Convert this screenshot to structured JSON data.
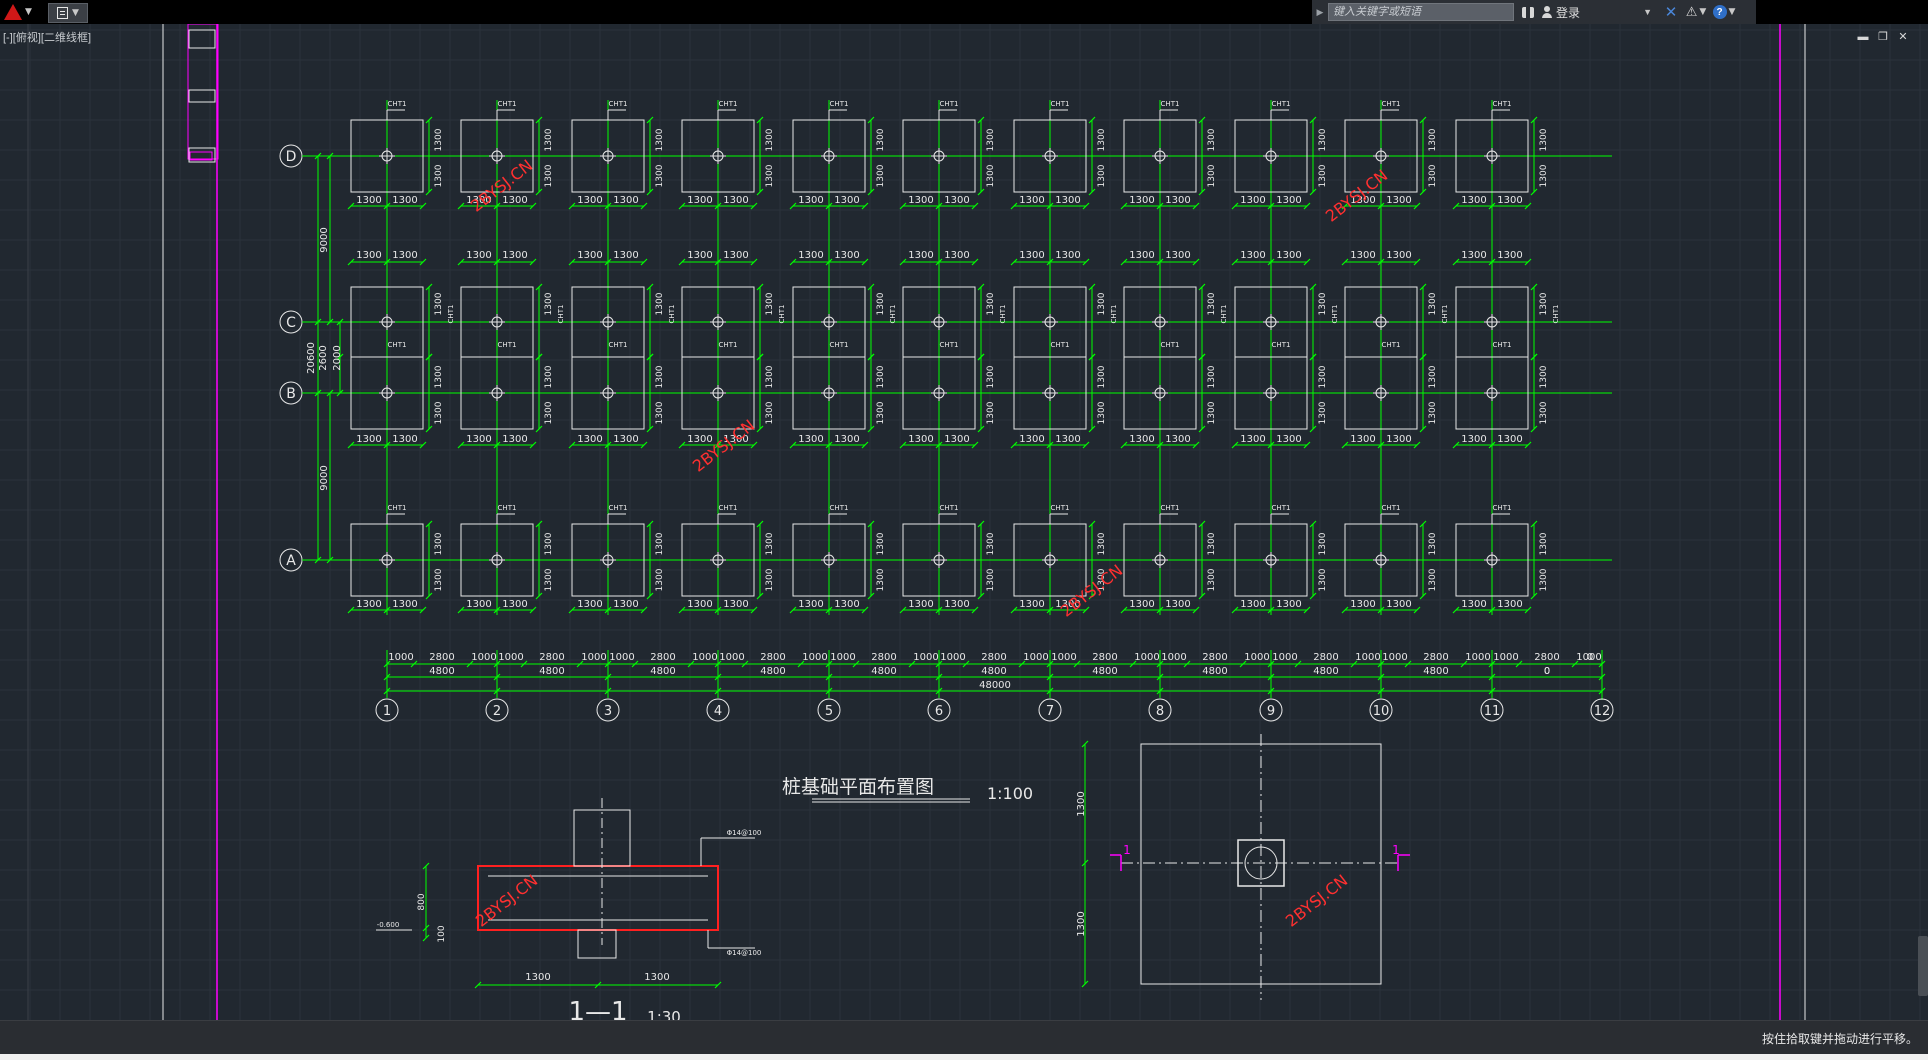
{
  "app": {
    "search_placeholder": "键入关键字或短语",
    "login_label": "登录",
    "viewport_label": "[-][俯视][二维线框]",
    "status_text": "按住拾取键并拖动进行平移。"
  },
  "drawing": {
    "plan_title": "桩基础平面布置图",
    "plan_scale": "1:100",
    "section_title": "1—1",
    "section_scale": "1:30",
    "watermark": "2BYSJ.CN",
    "cap_label": "CHT1",
    "cap_dim": "1300",
    "axis_rows": [
      "D",
      "C",
      "B",
      "A"
    ],
    "axis_cols": [
      "1",
      "2",
      "3",
      "4",
      "5",
      "6",
      "7",
      "8",
      "9",
      "10",
      "11",
      "12"
    ],
    "left_dims": {
      "top": "9000",
      "overall": "20600",
      "mid_a": "2600",
      "mid_b": "2000",
      "bottom": "9000"
    },
    "bottom_dims": {
      "row1": [
        "1000",
        "2800",
        "1000",
        "1000",
        "2800",
        "1000",
        "1000",
        "2800",
        "1000",
        "1000",
        "2800",
        "1000",
        "1000",
        "2800",
        "1000",
        "1000",
        "2800",
        "1000",
        "1000",
        "2800",
        "1000",
        "1000",
        "2800",
        "1000",
        "1000",
        "2800",
        "1000",
        "1000",
        "2800",
        "1000",
        "1000",
        "2800",
        "1000",
        "1000",
        "0",
        "0",
        "0"
      ],
      "row2": [
        "4800",
        "4800",
        "4800",
        "4800",
        "4800",
        "4800",
        "4800",
        "4800",
        "4800",
        "4800",
        "0"
      ],
      "total": "48000"
    },
    "section": {
      "level_mark": "-0.600",
      "rebar_top": "Φ14@100",
      "rebar_bottom": "Φ14@100",
      "dim_height": "800",
      "dim_small": "100",
      "dim_half": "1300"
    },
    "detail": {
      "dim_top": "1300",
      "dim_bottom": "1300",
      "cut_mark": "1"
    }
  },
  "colors": {
    "canvas_bg": "#212830",
    "grid_line": "#00ff00",
    "outline": "#e8e8e8",
    "accent": "#ff00ff",
    "watermark": "#ff3030",
    "highlight": "#ff2020"
  }
}
